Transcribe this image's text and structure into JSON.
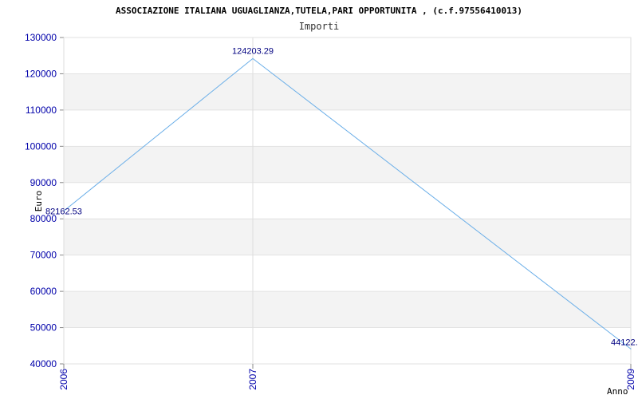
{
  "chart_data": {
    "type": "line",
    "title": "ASSOCIAZIONE ITALIANA UGUAGLIANZA,TUTELA,PARI OPPORTUNITA , (c.f.97556410013)",
    "subtitle": "Importi",
    "xlabel": "Anno",
    "ylabel": "Euro",
    "categories": [
      "2006",
      "2007",
      "2009"
    ],
    "values": [
      82162.53,
      124203.29,
      44122.0
    ],
    "value_labels": [
      "82162.53",
      "124203.29",
      "44122."
    ],
    "ylim": [
      40000,
      130000
    ],
    "yticks": [
      130000,
      120000,
      110000,
      100000,
      90000,
      80000,
      70000,
      60000,
      50000,
      40000
    ],
    "ytick_labels": [
      "130000",
      "120000",
      "110000",
      "100000",
      "90000",
      "80000",
      "70000",
      "60000",
      "50000",
      "40000"
    ],
    "grid": true,
    "line_color": "#6aaee8",
    "band_color": "#f3f3f3",
    "tick_color": "#0000aa"
  }
}
